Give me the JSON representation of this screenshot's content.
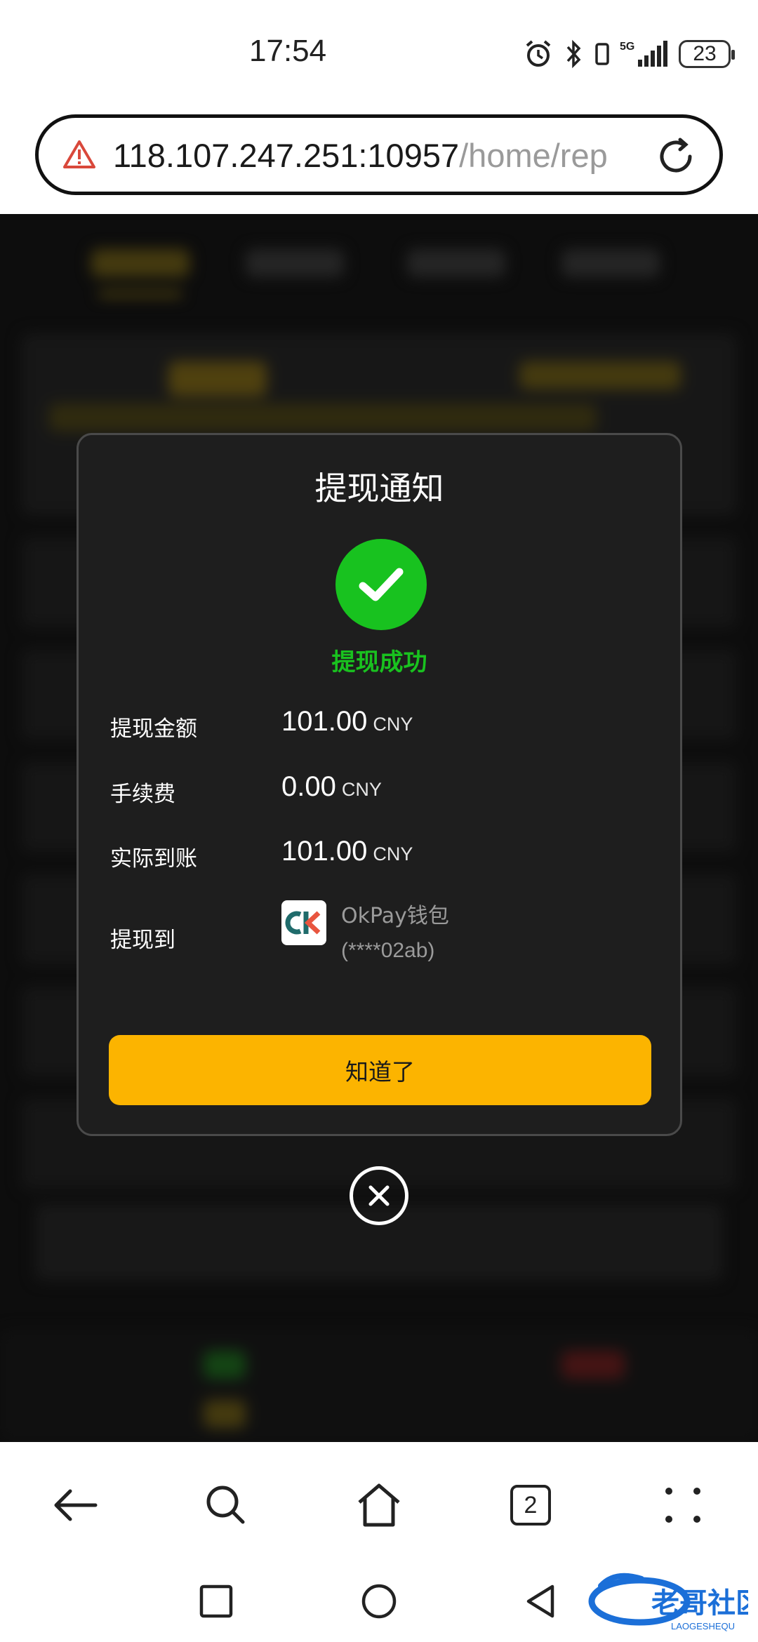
{
  "status_bar": {
    "time": "17:54",
    "network": "5G",
    "battery": "23",
    "icons": [
      "alarm-icon",
      "bluetooth-icon",
      "vibrate-icon",
      "signal-icon"
    ]
  },
  "browser": {
    "url_host": "118.107.247.251:10957",
    "url_path": "/home/rep",
    "tabs_count": "2"
  },
  "modal": {
    "title": "提现通知",
    "status_text": "提现成功",
    "rows": {
      "amount": {
        "label": "提现金额",
        "value": "101.00",
        "currency": "CNY"
      },
      "fee": {
        "label": "手续费",
        "value": "0.00",
        "currency": "CNY"
      },
      "actual": {
        "label": "实际到账",
        "value": "101.00",
        "currency": "CNY"
      },
      "destination": {
        "label": "提现到",
        "wallet_name": "OkPay钱包",
        "account": "(****02ab)"
      }
    },
    "confirm_label": "知道了"
  },
  "watermark": {
    "text": "老哥社区",
    "subtext": "LAOGESHEQU"
  },
  "colors": {
    "accent": "#fcb400",
    "success": "#18c21f",
    "modal_bg": "#1e1e1e",
    "page_bg": "#141414"
  }
}
